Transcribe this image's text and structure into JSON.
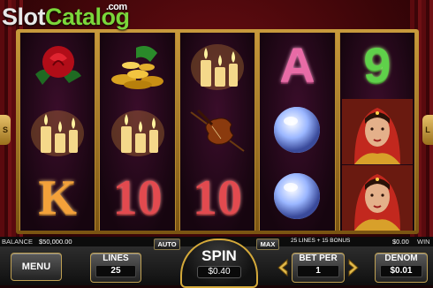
{
  "logo": {
    "part1": "Slot",
    "part2": "Catalog",
    "dotcom": ".com"
  },
  "side_arrows": {
    "left": "S",
    "right": "L"
  },
  "reels": [
    [
      "rose-icon",
      "candles-icon",
      "K"
    ],
    [
      "gold-coins-icon",
      "candles-icon",
      "10"
    ],
    [
      "candles-icon",
      "violin-icon",
      "10"
    ],
    [
      "A",
      "crystal-ball-icon",
      "crystal-ball-icon"
    ],
    [
      "9",
      "gypsy-woman-icon",
      "gypsy-woman-icon"
    ]
  ],
  "infobar": {
    "balance_label": "BALANCE",
    "balance_value": "$50,000.00",
    "lines_info": "25 LINES + 15 BONUS",
    "win_value": "$0.00",
    "win_label": "WIN"
  },
  "controls": {
    "auto_label": "AUTO",
    "max_label": "MAX",
    "menu_label": "MENU",
    "lines_label": "LINES",
    "lines_value": "25",
    "spin_label": "SPIN",
    "spin_value": "$0.40",
    "betper_label": "BET PER",
    "betper_value": "1",
    "denom_label": "DENOM",
    "denom_value": "$0.01"
  }
}
